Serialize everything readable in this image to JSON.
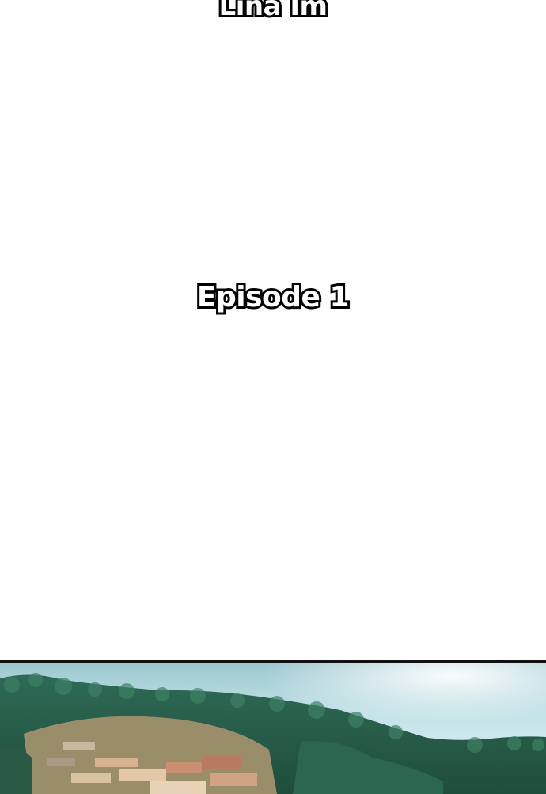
{
  "header": {
    "author": "Lina Im"
  },
  "title": {
    "episode": "Episode 1"
  },
  "panel": {
    "scene": "hillside-village-illustration"
  }
}
